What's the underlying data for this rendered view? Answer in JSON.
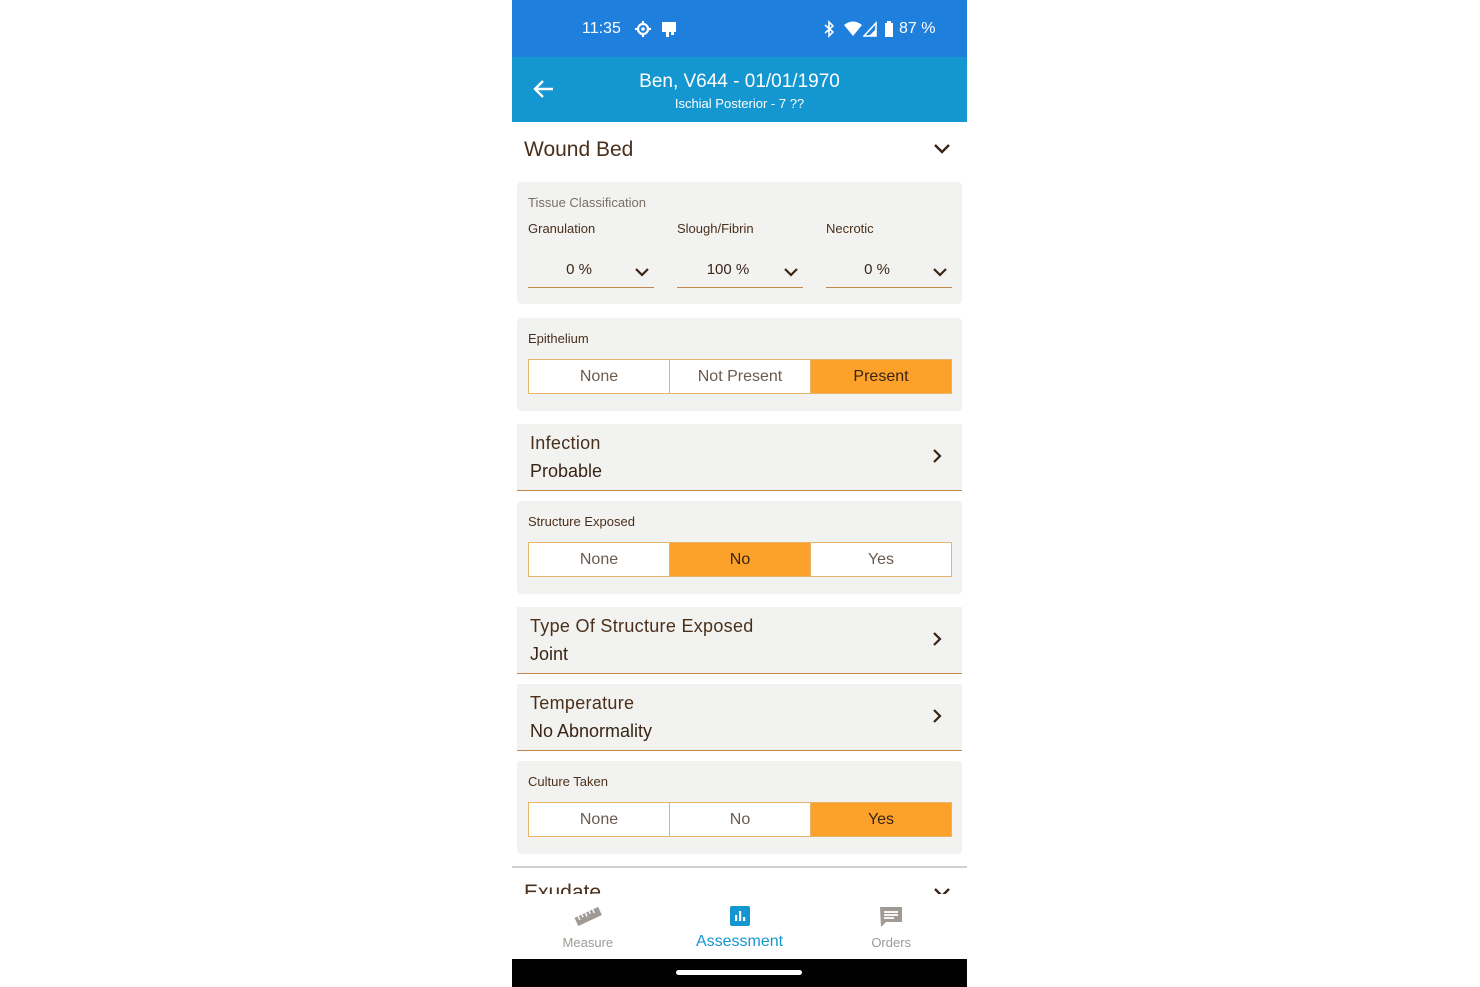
{
  "status_bar": {
    "time": "11:35",
    "battery": "87 %"
  },
  "app_bar": {
    "title": "Ben, V644 - 01/01/1970",
    "subtitle": "Ischial Posterior - 7 ??"
  },
  "wound_bed": {
    "title": "Wound Bed",
    "tissue": {
      "label": "Tissue Classification",
      "granulation": {
        "label": "Granulation",
        "value": "0 %"
      },
      "slough": {
        "label": "Slough/Fibrin",
        "value": "100 %"
      },
      "necrotic": {
        "label": "Necrotic",
        "value": "0 %"
      }
    },
    "epithelium": {
      "label": "Epithelium",
      "options": [
        "None",
        "Not Present",
        "Present"
      ],
      "selected": "Present"
    },
    "infection": {
      "title": "Infection",
      "value": "Probable"
    },
    "structure_exposed": {
      "label": "Structure Exposed",
      "options": [
        "None",
        "No",
        "Yes"
      ],
      "selected": "No"
    },
    "type_of_structure": {
      "title": "Type Of Structure Exposed",
      "value": "Joint"
    },
    "temperature": {
      "title": "Temperature",
      "value": "No Abnormality"
    },
    "culture_taken": {
      "label": "Culture Taken",
      "options": [
        "None",
        "No",
        "Yes"
      ],
      "selected": "Yes"
    }
  },
  "exudate": {
    "title": "Exudate"
  },
  "bottom_nav": {
    "measure": "Measure",
    "assessment": "Assessment",
    "orders": "Orders",
    "active": "Assessment"
  },
  "colors": {
    "status_bar": "#1f7fdc",
    "app_bar": "#1496d0",
    "accent": "#fca22a",
    "text": "#4a2f1a"
  }
}
